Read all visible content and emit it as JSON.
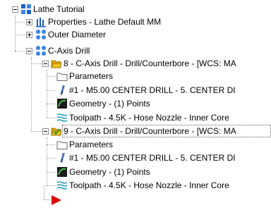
{
  "tree": {
    "root": {
      "label": "Lathe Tutorial",
      "icon": "machine-group-icon",
      "state": "expanded"
    },
    "properties": {
      "label": "Properties - Lathe Default MM",
      "icon": "properties-icon",
      "state": "collapsed"
    },
    "outer_diameter": {
      "label": "Outer Diameter",
      "icon": "toolpath-group-icon",
      "state": "collapsed"
    },
    "c_axis_drill": {
      "label": "C-Axis Drill",
      "icon": "toolpath-group-icon",
      "state": "expanded"
    },
    "operations": [
      {
        "label": "8 - C-Axis Drill - Drill/Counterbore - [WCS: MA",
        "icon": "open-folder-icon",
        "selected": false,
        "children": {
          "parameters": "Parameters",
          "tool": "#1 - M5.00 CENTER DRILL -    5. CENTER DI",
          "geometry": "Geometry - (1) Points",
          "toolpath": "Toolpath - 4.5K - Hose Nozzle  - Inner Core"
        }
      },
      {
        "label": "9 - C-Axis Drill - Drill/Counterbore - [WCS: MA",
        "icon": "selected-open-folder-icon",
        "selected": true,
        "children": {
          "parameters": "Parameters",
          "tool": "#1 - M5.00 CENTER DRILL -    5. CENTER DI",
          "geometry": "Geometry - (1) Points",
          "toolpath": "Toolpath - 4.5K - Hose Nozzle  - Inner Core"
        }
      }
    ],
    "insert_marker": {
      "icon": "insert-arrow-icon",
      "color": "#e00000"
    }
  },
  "colors": {
    "accent_blue": "#1c5fc8",
    "folder_yellow": "#f0c419",
    "insert_red": "#e00000",
    "selection_check": "#2f8f2f"
  }
}
